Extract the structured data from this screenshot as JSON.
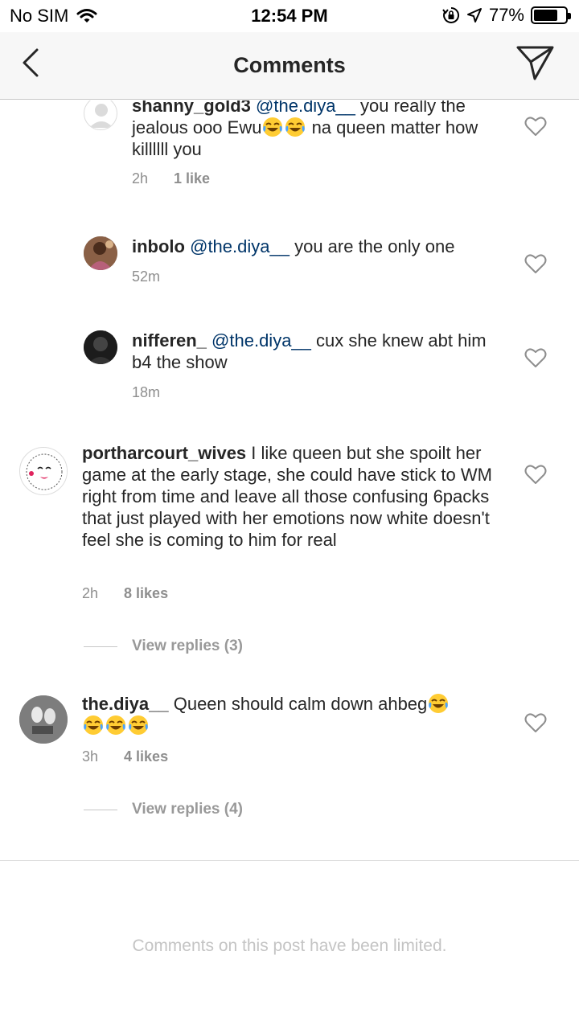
{
  "status": {
    "carrier": "No SIM",
    "time": "12:54 PM",
    "battery": "77%",
    "battery_level": 0.77
  },
  "header": {
    "title": "Comments"
  },
  "comments": [
    {
      "username": "shanny_gold3",
      "mention": "@the.diya__",
      "text_parts": [
        " you really the jealous ooo Ewu",
        " na queen matter how killllll you"
      ],
      "time": "2h",
      "likes": "1 like"
    },
    {
      "username": "inbolo",
      "mention": "@the.diya__",
      "text": " you are the only one",
      "time": "52m"
    },
    {
      "username": "nifferen_",
      "mention": "@the.diya__",
      "text": " cux she knew abt him b4 the show",
      "time": "18m"
    },
    {
      "username": "portharcourt_wives",
      "text": " I like queen but she spoilt her game at the early stage, she could have stick to WM right from time and leave all those confusing 6packs that just played with her emotions now white doesn't feel she is coming to him for real",
      "time": "2h",
      "likes": "8 likes",
      "replies": "View replies (3)"
    },
    {
      "username": "the.diya__",
      "text": " Queen should calm down ahbeg",
      "time": "3h",
      "likes": "4 likes",
      "replies": "View replies (4)"
    }
  ],
  "footer": {
    "limited_text": "Comments on this post have been limited."
  },
  "icons": {
    "back": "chevron-left-icon",
    "send": "paper-plane-icon",
    "like": "heart-outline-icon",
    "emoji": "tears-of-joy-emoji"
  }
}
